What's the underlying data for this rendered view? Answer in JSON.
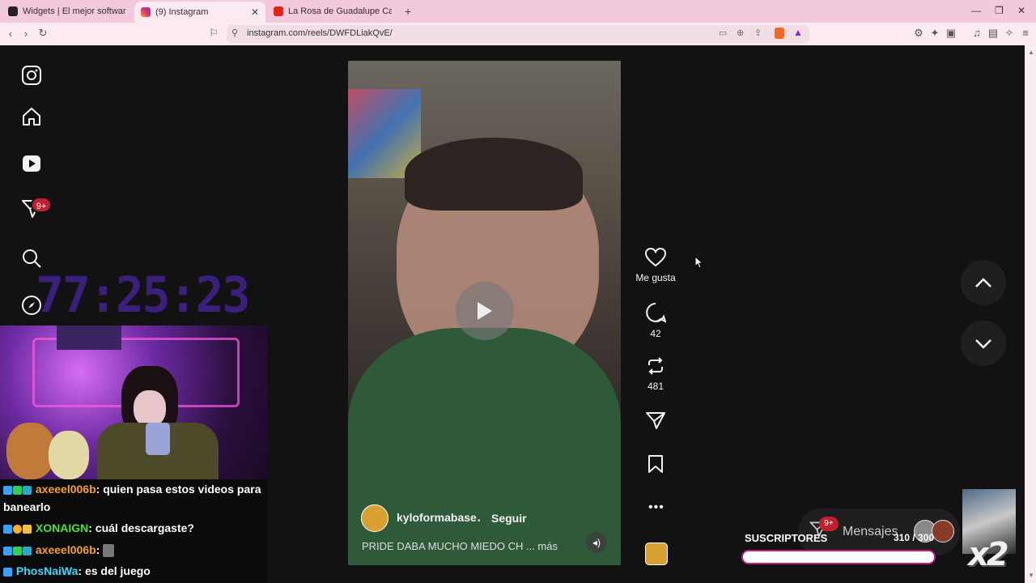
{
  "browser": {
    "tabs": [
      {
        "title": "Widgets | El mejor software para pot",
        "icon": "widgets-favicon"
      },
      {
        "title": "(9) Instagram",
        "icon": "instagram-favicon"
      },
      {
        "title": "La Rosa de Guadalupe Capítulo ESTA",
        "icon": "youtube-favicon"
      }
    ],
    "url": "instagram.com/reels/DWFDLiakQvE/"
  },
  "sidebar": {
    "notifications_badge": "9+"
  },
  "stream": {
    "timer": "77:25:23",
    "chat": [
      {
        "user": "axeeel006b",
        "sep": ": ",
        "message": "quien pasa estos videos para banearlo",
        "user_color": "#f0a030"
      },
      {
        "user": "XONAIGN",
        "sep": ": ",
        "message": "cuál descargaste?",
        "user_color": "#49e03a"
      },
      {
        "user": "axeeel006b",
        "sep": ": ",
        "message": "",
        "user_color": "#f0a030"
      },
      {
        "user": "PhosNaiWa",
        "sep": ": ",
        "message": "es del juego",
        "user_color": "#3fd6ff"
      }
    ],
    "subs_label": "SUSCRIPTORES",
    "subs_count": "310 / 300",
    "subs_progress": 1.0,
    "multiplier": "x2",
    "messages_label": "Mensajes",
    "messages_badge": "9+"
  },
  "reel": {
    "username": "kyloformabase",
    "follow_label": "Seguir",
    "caption": "PRIDE DABA MUCHO MIEDO CH",
    "more_label": "... más",
    "actions": {
      "like_label": "Me gusta",
      "comments": "42",
      "reposts": "481"
    }
  },
  "colors": {
    "tabbar": "#f3c9dd",
    "accent_pink": "#c21e88",
    "timer": "#3b1f7d"
  }
}
